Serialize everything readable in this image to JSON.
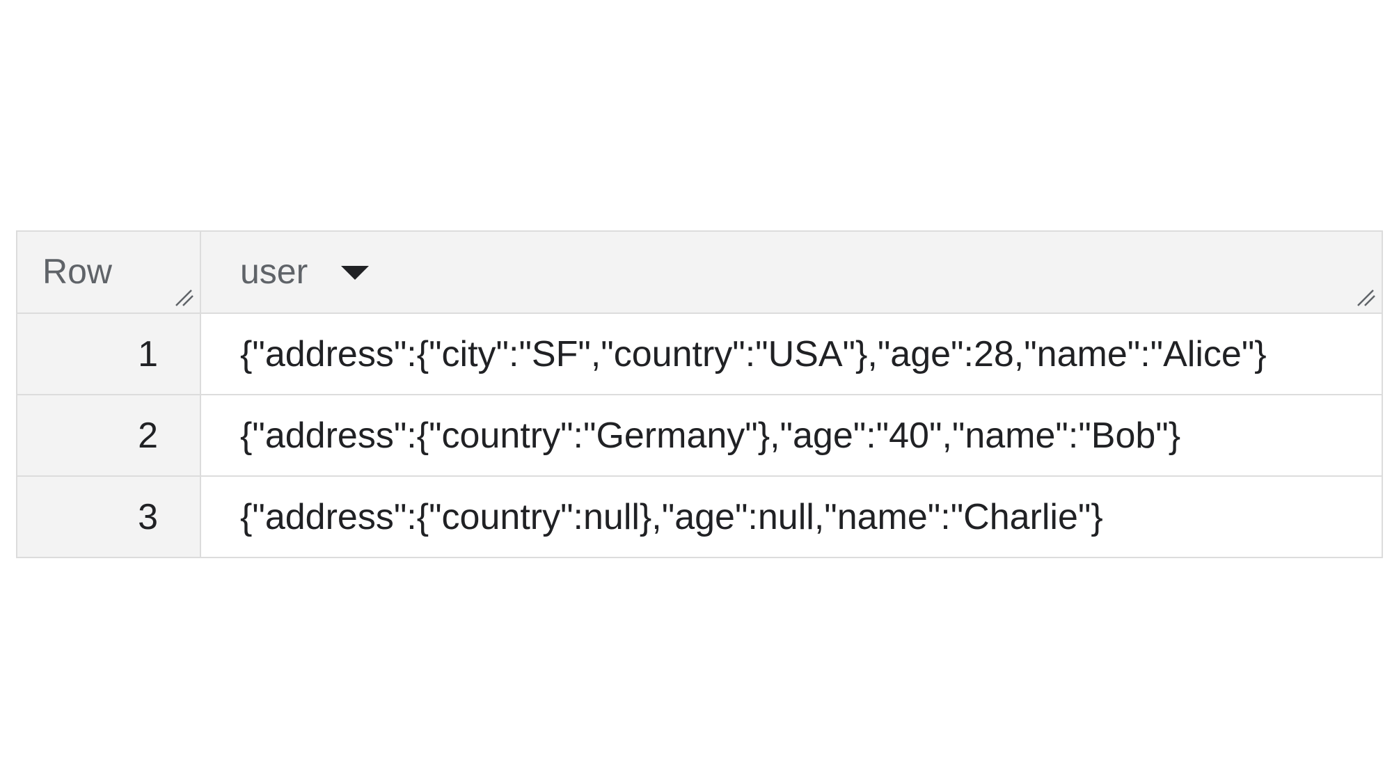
{
  "table": {
    "columns": [
      {
        "label": "Row"
      },
      {
        "label": "user",
        "sort_icon": "dropdown-arrow-icon"
      }
    ],
    "resize_icon": "column-resize-handle-icon",
    "rows": [
      {
        "row": "1",
        "user": "{\"address\":{\"city\":\"SF\",\"country\":\"USA\"},\"age\":28,\"name\":\"Alice\"}"
      },
      {
        "row": "2",
        "user": "{\"address\":{\"country\":\"Germany\"},\"age\":\"40\",\"name\":\"Bob\"}"
      },
      {
        "row": "3",
        "user": "{\"address\":{\"country\":null},\"age\":null,\"name\":\"Charlie\"}"
      }
    ]
  },
  "colors": {
    "header_bg": "#f3f3f3",
    "border": "#dcdcdc",
    "text": "#202124",
    "header_text": "#5f6368"
  }
}
